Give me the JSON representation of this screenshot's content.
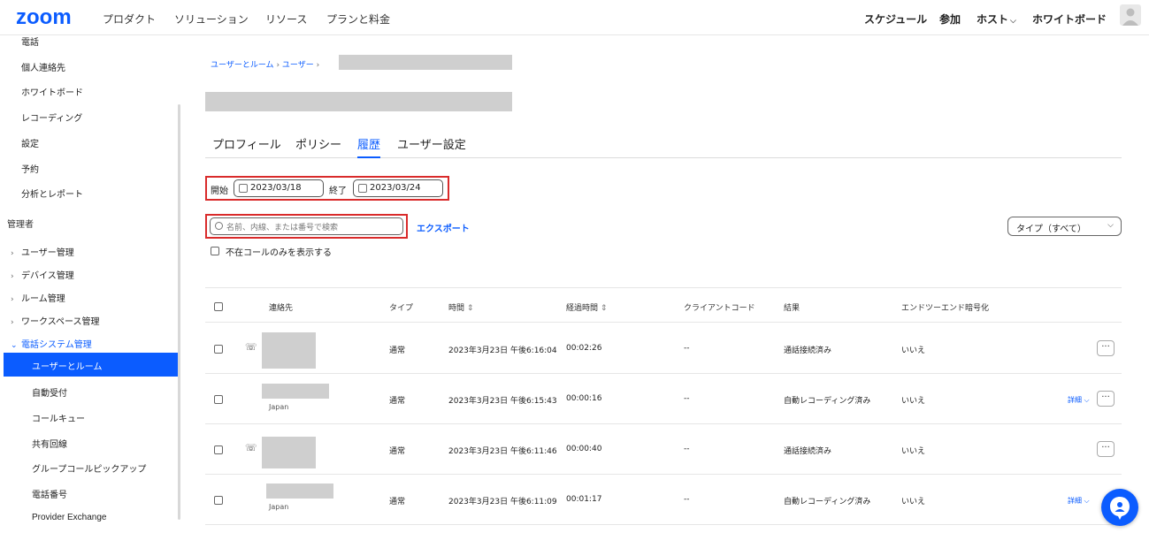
{
  "topnav": {
    "logo": "zoom",
    "left_items": [
      "プロダクト",
      "ソリューション",
      "リソース",
      "プランと料金"
    ],
    "right_items": [
      "スケジュール",
      "参加",
      "ホスト",
      "ホワイトボード"
    ]
  },
  "sidebar": {
    "items": [
      "電話",
      "個人連絡先",
      "ホワイトボード",
      "レコーディング",
      "設定",
      "予約",
      "分析とレポート"
    ],
    "section_admin": "管理者",
    "groups": [
      "ユーザー管理",
      "デバイス管理",
      "ルーム管理",
      "ワークスペース管理",
      "電話システム管理"
    ],
    "active_sub": "ユーザーとルーム",
    "subs": [
      "自動受付",
      "コールキュー",
      "共有回線",
      "グループコールピックアップ",
      "電話番号",
      "Provider Exchange"
    ]
  },
  "breadcrumb": {
    "item1": "ユーザーとルーム",
    "item2": "ユーザー"
  },
  "tabs": [
    "プロフィール",
    "ポリシー",
    "履歴",
    "ユーザー設定"
  ],
  "filters": {
    "start_label": "開始",
    "start_date": "2023/03/18",
    "end_label": "終了",
    "end_date": "2023/03/24",
    "search_placeholder": "名前、内線、または番号で検索",
    "export": "エクスポート",
    "type_select": "タイプ（すべて）",
    "missed_only": "不在コールのみを表示する"
  },
  "table": {
    "headers": [
      "連絡先",
      "タイプ",
      "時間",
      "経過時間",
      "クライアントコード",
      "結果",
      "エンドツーエンド暗号化"
    ],
    "rows": [
      {
        "type": "通常",
        "time": "2023年3月23日 午後6:16:04",
        "duration": "00:02:26",
        "client_code": "--",
        "result": "通話接続済み",
        "e2e": "いいえ",
        "sub": "",
        "detail": ""
      },
      {
        "type": "通常",
        "time": "2023年3月23日 午後6:15:43",
        "duration": "00:00:16",
        "client_code": "--",
        "result": "自動レコーディング済み",
        "e2e": "いいえ",
        "sub": "Japan",
        "detail": "詳細"
      },
      {
        "type": "通常",
        "time": "2023年3月23日 午後6:11:46",
        "duration": "00:00:40",
        "client_code": "--",
        "result": "通話接続済み",
        "e2e": "いいえ",
        "sub": "",
        "detail": ""
      },
      {
        "type": "通常",
        "time": "2023年3月23日 午後6:11:09",
        "duration": "00:01:17",
        "client_code": "--",
        "result": "自動レコーディング済み",
        "e2e": "いいえ",
        "sub": "Japan",
        "detail": "詳細"
      }
    ]
  },
  "colors": {
    "accent": "#0b5cff",
    "highlight_border": "#d92b2b"
  },
  "icons": {
    "phone": "phone-icon",
    "calendar": "calendar-icon",
    "search": "search-icon",
    "more": "more-icon",
    "chat": "chat-icon"
  }
}
